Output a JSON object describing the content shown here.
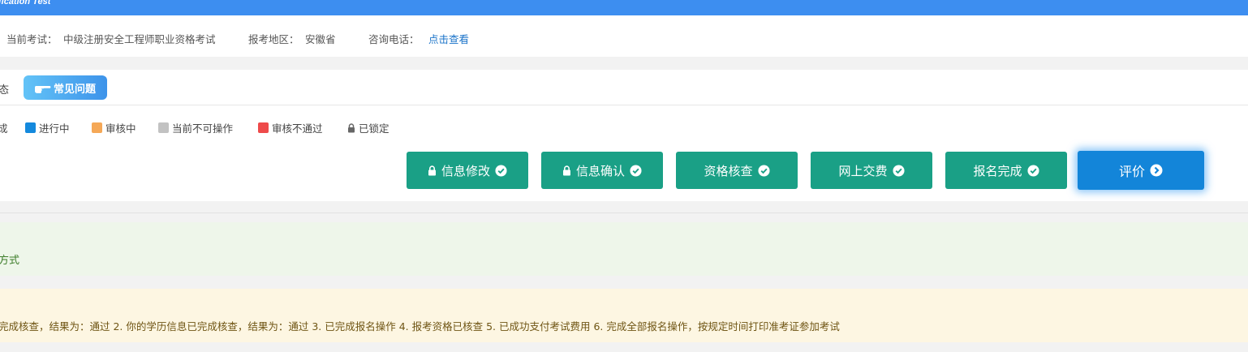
{
  "header": {
    "title": "fication Test"
  },
  "info": {
    "exam_label": "当前考试：",
    "exam_value": "中级注册安全工程师职业资格考试",
    "region_label": "报考地区：",
    "region_value": "安徽省",
    "phone_label": "咨询电话：",
    "phone_link": "点击查看"
  },
  "tabs": {
    "status_partial": "态",
    "faq_label": "常见问题"
  },
  "legend": [
    {
      "label": "成",
      "color": ""
    },
    {
      "label": "进行中",
      "color": "#1489dd"
    },
    {
      "label": "审核中",
      "color": "#f5a857"
    },
    {
      "label": "当前不可操作",
      "color": "#c2c2c2"
    },
    {
      "label": "审核不通过",
      "color": "#ee4a4a"
    },
    {
      "label": "已锁定",
      "color": ""
    }
  ],
  "steps": [
    {
      "label": "信息修改",
      "locked": true,
      "done": true
    },
    {
      "label": "信息确认",
      "locked": true,
      "done": true
    },
    {
      "label": "资格核查",
      "locked": false,
      "done": true
    },
    {
      "label": "网上交费",
      "locked": false,
      "done": true
    },
    {
      "label": "报名完成",
      "locked": false,
      "done": true
    },
    {
      "label": "评价",
      "locked": false,
      "done": false
    }
  ],
  "colors": {
    "step_done": "#1aa086",
    "step_active": "#1385d9",
    "topbar": "#3d8ef0"
  },
  "alerts": {
    "green": "方式",
    "yellow": "完成核查，结果为：通过 2. 你的学历信息已完成核查，结果为：通过 3. 已完成报名操作 4. 报考资格已核查 5. 已成功支付考试费用 6. 完成全部报名操作，按规定时间打印准考证参加考试"
  }
}
